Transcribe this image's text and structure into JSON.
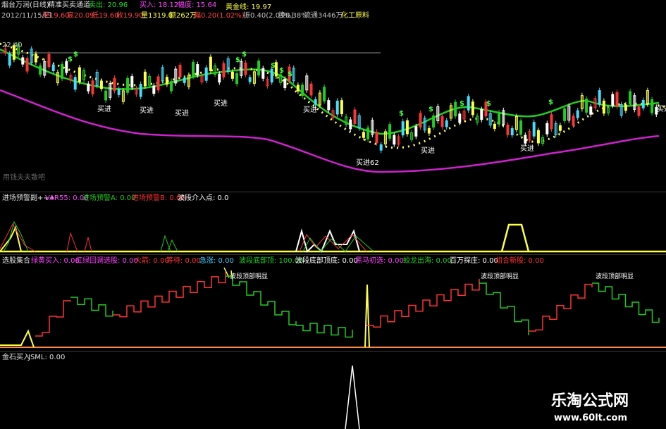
{
  "main": {
    "title": "烟台万润(日线)",
    "indicator_name": "精准买卖通道",
    "sell_label": "卖出: 20.96",
    "buy_label": "买入: 18.12",
    "amplitude_label": "幅度: 15.64",
    "gold_line_label": "黄金线: 19.97",
    "quote": {
      "date": "2012/11/15/四",
      "open": "开19.60",
      "high": "高20.09",
      "low": "低19.60",
      "close": "收19.90",
      "volume": "量1319.0",
      "amount": "额262万",
      "change": "幅0.20(1.02%)",
      "swing": "振0.40(2.03%)",
      "turnover": "换0.38%",
      "float_shares": "流通3446万",
      "sector": "化工原料"
    },
    "level_label": "22.40",
    "signals": {
      "buy": "买进",
      "low": "买进62",
      "sell_mark": "$"
    },
    "watermark": "用钱夫夫散吧"
  },
  "pane2": {
    "title": "进场预警副+++",
    "items": [
      {
        "label": "VAR55: 0.00",
        "color": "#ff44ff"
      },
      {
        "label": "进场预警A: 0.00",
        "color": "#22cc22"
      },
      {
        "label": "进场预警B: 0.00",
        "color": "#ff3333"
      },
      {
        "label": "波段介入点: 0.0",
        "color": "#ffffff"
      }
    ]
  },
  "pane3": {
    "title": "选股集合",
    "items": [
      {
        "label": "绿黄买入: 0.00",
        "color": "#ff44ff"
      },
      {
        "label": "红绿回调选股: 0.00",
        "color": "#ff44ff"
      },
      {
        "label": "火箭: 0.00",
        "color": "#ff3333"
      },
      {
        "label": "等待: 0.00",
        "color": "#ff3333"
      },
      {
        "label": "急涨: 0.00",
        "color": "#44ccff"
      },
      {
        "label": "波段底部顶: 100.00",
        "color": "#22cc22"
      },
      {
        "label": "波段底部顶底: 0.00",
        "color": "#ffffff"
      },
      {
        "label": "黑马初选: 0.00",
        "color": "#ff44ff"
      },
      {
        "label": "蛟龙出海: 0.00",
        "color": "#22cc22"
      },
      {
        "label": "百万探庄: 0.00",
        "color": "#ffffff"
      },
      {
        "label": "组合新股: 0.00",
        "color": "#ff3333"
      }
    ],
    "top_label": "波段顶部明显"
  },
  "pane4": {
    "title": "金石买入",
    "value": "JSML: 0.00"
  },
  "brand": {
    "name": "乐淘公式网",
    "url": "www.60lt.com"
  }
}
